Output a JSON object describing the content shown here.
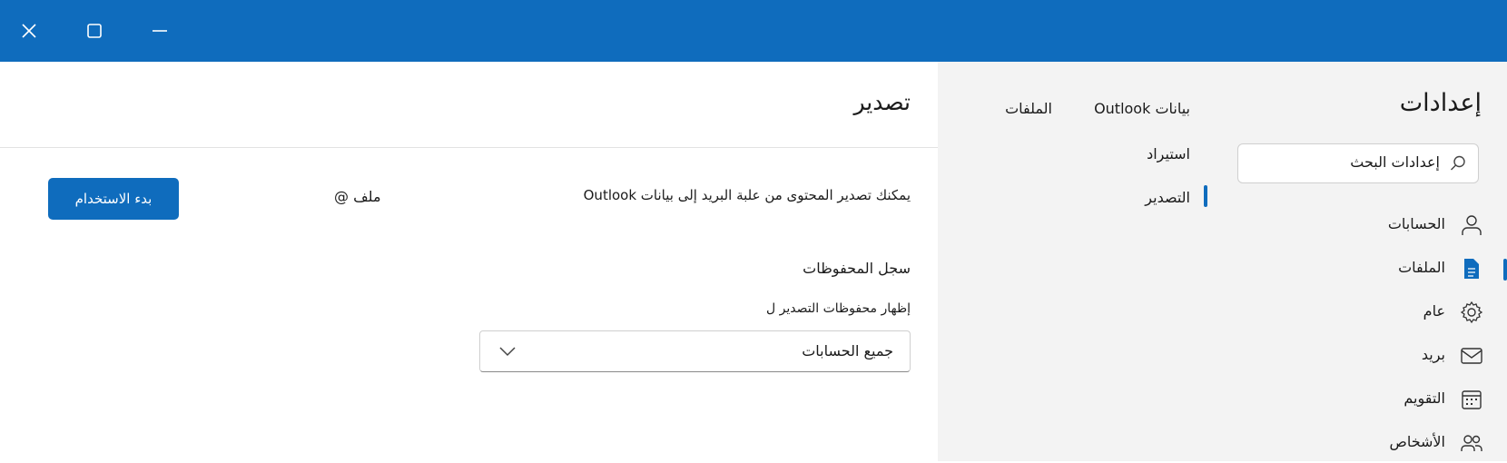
{
  "window": {
    "close_icon": "close-icon",
    "maximize_icon": "maximize-icon",
    "minimize_icon": "minimize-icon",
    "titlebar_color": "#0f6cbd"
  },
  "nav": {
    "title": "إعدادات",
    "search_placeholder": "إعدادات البحث",
    "items": [
      {
        "label": "الحسابات",
        "icon": "person-icon",
        "selected": false
      },
      {
        "label": "الملفات",
        "icon": "document-icon",
        "selected": true
      },
      {
        "label": "عام",
        "icon": "gear-icon",
        "selected": false
      },
      {
        "label": "بريد",
        "icon": "mail-icon",
        "selected": false
      },
      {
        "label": "التقويم",
        "icon": "calendar-icon",
        "selected": false
      },
      {
        "label": "الأشخاص",
        "icon": "people-icon",
        "selected": false
      }
    ]
  },
  "sub": {
    "tabs": [
      {
        "label": "بيانات Outlook",
        "selected": true
      },
      {
        "label": "الملفات",
        "selected": false
      }
    ],
    "items": [
      {
        "label": "استيراد",
        "selected": false
      },
      {
        "label": "التصدير",
        "selected": true
      }
    ]
  },
  "content": {
    "title": "تصدير",
    "description": "يمكنك تصدير المحتوى من علبة البريد إلى بيانات Outlook",
    "file_label": "ملف @",
    "start_button": "بدء الاستخدام",
    "history_title": "سجل المحفوظات",
    "show_label": "إظهار محفوظات التصدير ل",
    "dropdown_value": "جميع الحسابات"
  },
  "accent_color": "#0f6cbd"
}
